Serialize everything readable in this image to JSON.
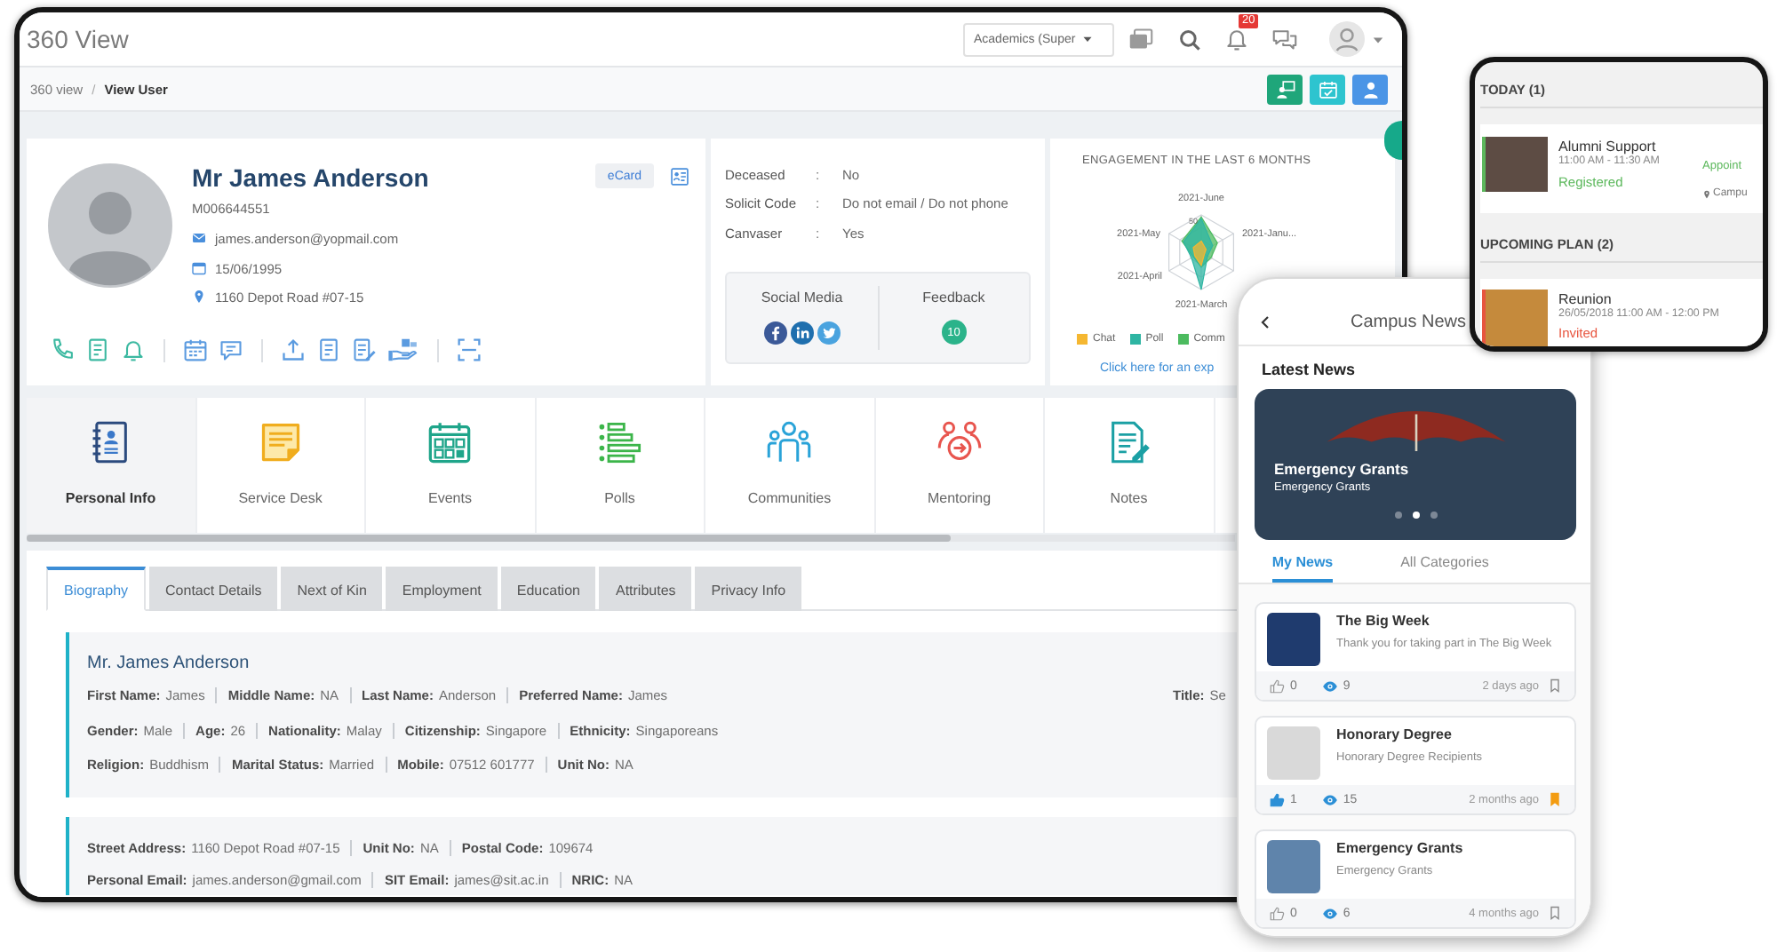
{
  "window": {
    "title": "360 View"
  },
  "header": {
    "role": "Academics (Super",
    "notification_count": "20"
  },
  "breadcrumb": {
    "separator": "/",
    "items": [
      {
        "label": "360 view",
        "current": false
      },
      {
        "label": "View User",
        "current": true
      }
    ]
  },
  "profile": {
    "name": "Mr James Anderson",
    "member_id": "M006644551",
    "email": "james.anderson@yopmail.com",
    "birth_date": "15/06/1995",
    "address": "1160 Depot Road #07-15",
    "ecard_button": "eCard"
  },
  "details": {
    "rows": [
      {
        "label": "Deceased",
        "separator": ":",
        "value": "No"
      },
      {
        "label": "Solicit Code",
        "separator": ":",
        "value": "Do not email / Do not phone"
      },
      {
        "label": "Canvaser",
        "separator": ":",
        "value": "Yes"
      }
    ]
  },
  "social_media": {
    "title": "Social Media"
  },
  "feedback": {
    "title": "Feedback",
    "count": "10"
  },
  "engagement": {
    "title": "ENGAGEMENT IN THE LAST 6 MONTHS",
    "axis_labels": [
      "2021-June",
      "2021-Janu...",
      "2021-May",
      "2021-April",
      "2021-March"
    ],
    "scale_label": "50",
    "legend": [
      {
        "label": "Chat",
        "color": "#f5b731"
      },
      {
        "label": "Poll",
        "color": "#2eb5a3"
      },
      {
        "label": "Comm",
        "color": "#4cbb5f"
      }
    ],
    "link": "Click here for an exp"
  },
  "modules": [
    {
      "label": "Personal Info",
      "selected": true
    },
    {
      "label": "Service Desk",
      "selected": false
    },
    {
      "label": "Events",
      "selected": false
    },
    {
      "label": "Polls",
      "selected": false
    },
    {
      "label": "Communities",
      "selected": false
    },
    {
      "label": "Mentoring",
      "selected": false
    },
    {
      "label": "Notes",
      "selected": false
    }
  ],
  "tabs": [
    {
      "label": "Biography",
      "selected": true
    },
    {
      "label": "Contact Details",
      "selected": false
    },
    {
      "label": "Next of Kin",
      "selected": false
    },
    {
      "label": "Employment",
      "selected": false
    },
    {
      "label": "Education",
      "selected": false
    },
    {
      "label": "Attributes",
      "selected": false
    },
    {
      "label": "Privacy Info",
      "selected": false
    }
  ],
  "biography": {
    "heading": "Mr. James Anderson",
    "rows": [
      {
        "fields": [
          {
            "label": "First Name:",
            "value": "James"
          },
          {
            "label": "Middle Name:",
            "value": "NA"
          },
          {
            "label": "Last Name:",
            "value": "Anderson"
          },
          {
            "label": "Preferred Name:",
            "value": "James"
          }
        ]
      },
      {
        "fields": [
          {
            "label": "Gender:",
            "value": "Male"
          },
          {
            "label": "Age:",
            "value": "26"
          },
          {
            "label": "Nationality:",
            "value": "Malay"
          },
          {
            "label": "Citizenship:",
            "value": "Singapore"
          },
          {
            "label": "Ethnicity:",
            "value": "Singaporeans"
          }
        ]
      },
      {
        "fields": [
          {
            "label": "Religion:",
            "value": "Buddhism"
          },
          {
            "label": "Marital Status:",
            "value": "Married"
          },
          {
            "label": "Mobile:",
            "value": "07512 601777"
          },
          {
            "label": "Unit No:",
            "value": "NA"
          }
        ]
      }
    ],
    "aside": {
      "label": "Title:",
      "value": "Se"
    }
  },
  "address": {
    "rows": [
      {
        "fields": [
          {
            "label": "Street Address:",
            "value": "1160 Depot Road #07-15"
          },
          {
            "label": "Unit No:",
            "value": "NA"
          },
          {
            "label": "Postal Code:",
            "value": "109674"
          }
        ]
      },
      {
        "fields": [
          {
            "label": "Personal Email:",
            "value": "james.anderson@gmail.com"
          },
          {
            "label": "SIT Email:",
            "value": "james@sit.ac.in"
          },
          {
            "label": "NRIC:",
            "value": "NA"
          }
        ]
      }
    ]
  },
  "phone": {
    "title": "Campus News",
    "section_title": "Latest News",
    "banner": {
      "title": "Emergency Grants",
      "subtitle": "Emergency Grants",
      "dots": [
        {
          "selected": false
        },
        {
          "selected": true
        },
        {
          "selected": false
        }
      ]
    },
    "tabs": [
      {
        "label": "My News",
        "selected": true
      },
      {
        "label": "All Categories",
        "selected": false
      }
    ],
    "news": [
      {
        "title": "The Big Week",
        "summary": "Thank you for taking part in The Big Week",
        "likes": "0",
        "liked": false,
        "views": "9",
        "time": "2 days ago",
        "bookmarked": false
      },
      {
        "title": "Honorary Degree",
        "summary": "Honorary Degree Recipients",
        "likes": "1",
        "liked": true,
        "views": "15",
        "time": "2 months ago",
        "bookmarked": true
      },
      {
        "title": "Emergency Grants",
        "summary": "Emergency Grants",
        "likes": "0",
        "liked": false,
        "views": "6",
        "time": "4 months ago",
        "bookmarked": false
      }
    ]
  },
  "agenda": {
    "sections": [
      {
        "title": "TODAY (1)",
        "events": [
          {
            "title": "Alumni Support",
            "time": "11:00 AM - 11:30 AM",
            "status": "Registered",
            "color": "#5cb85c",
            "tag": "Appoint",
            "location": "Campu"
          }
        ]
      },
      {
        "title": "UPCOMING PLAN (2)",
        "events": [
          {
            "title": "Reunion",
            "time": "26/05/2018 11:00 AM - 12:00 PM",
            "status": "Invited",
            "color": "#e8553f"
          }
        ]
      }
    ]
  }
}
